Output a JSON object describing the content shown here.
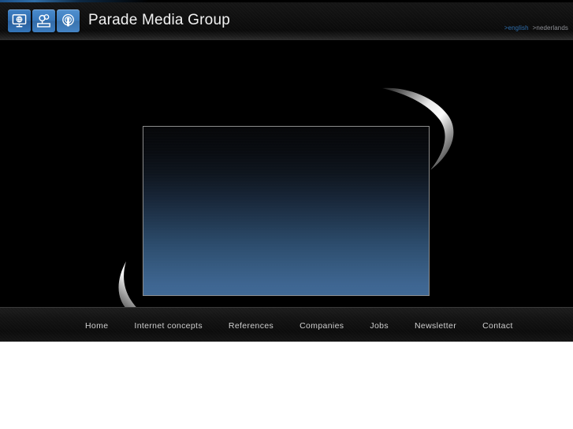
{
  "site": {
    "title": "Parade Media Group",
    "background_color": "#000000",
    "accent_color": "#2f6fae",
    "panel_top_color": "#050608",
    "panel_bottom_color": "#3f6894"
  },
  "header": {
    "logo_icons": [
      {
        "name": "monitor-globe-icon",
        "label": "Internet"
      },
      {
        "name": "speech-bubbles-icon",
        "label": "Communication"
      },
      {
        "name": "broadcast-microphone-icon",
        "label": "Broadcast"
      }
    ],
    "title": "Parade Media Group"
  },
  "language": {
    "marker": ">",
    "options": [
      {
        "label": "english",
        "code": "en",
        "color": "#2f6fae",
        "active": true
      },
      {
        "label": "nederlands",
        "code": "nl",
        "color": "#8f9197",
        "active": false
      }
    ]
  },
  "hero": {
    "panel_alt": "",
    "decorations": [
      {
        "name": "swoosh-top-right",
        "style": "chrome-curve"
      },
      {
        "name": "swoosh-bottom-left",
        "style": "chrome-curve"
      }
    ]
  },
  "nav": {
    "items": [
      {
        "label": "Home"
      },
      {
        "label": "Internet concepts"
      },
      {
        "label": "References"
      },
      {
        "label": "Companies"
      },
      {
        "label": "Jobs"
      },
      {
        "label": "Newsletter"
      },
      {
        "label": "Contact"
      }
    ]
  }
}
